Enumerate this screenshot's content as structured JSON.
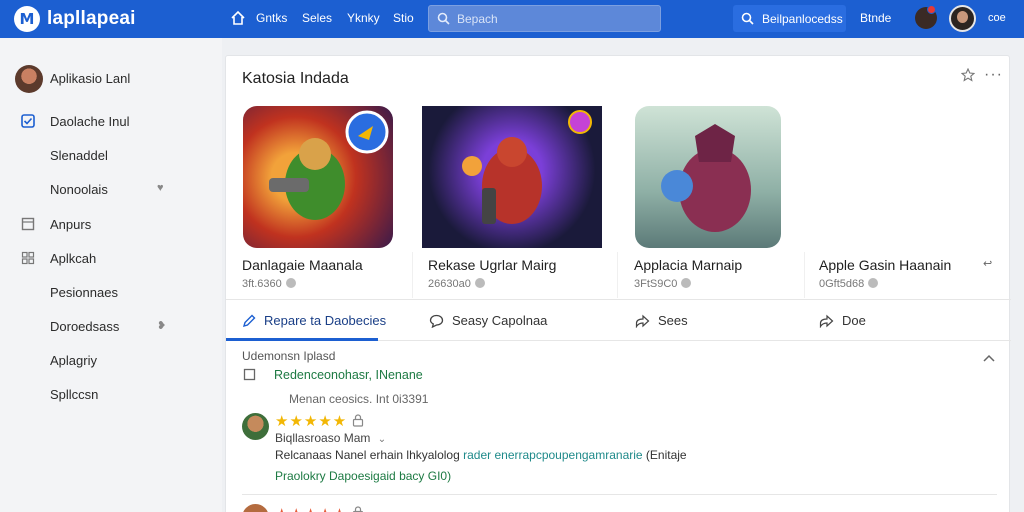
{
  "header": {
    "brand": "lapllapeai",
    "nav": [
      "Gntks",
      "Seles",
      "Yknky",
      "Stio"
    ],
    "search_placeholder": "Bepach",
    "search_button": "Beilpanlocedss",
    "right_link": "Btnde",
    "right_small": "coe"
  },
  "sidebar": {
    "profile_name": "Aplikasio Lanl",
    "items": [
      {
        "label": "Daolache Inul",
        "icon": "checkbox-icon",
        "chevron": ""
      },
      {
        "label": "Slenaddel",
        "icon": "",
        "chevron": ""
      },
      {
        "label": "Nonoolais",
        "icon": "",
        "chevron": "heart-icon"
      },
      {
        "label": "Anpurs",
        "icon": "box-icon",
        "chevron": ""
      },
      {
        "label": "Aplkcah",
        "icon": "grid-icon",
        "chevron": ""
      },
      {
        "label": "Pesionnaes",
        "icon": "",
        "chevron": ""
      },
      {
        "label": "Doroedsass",
        "icon": "",
        "chevron": "chevron-icon"
      },
      {
        "label": "Aplagriy",
        "icon": "",
        "chevron": ""
      },
      {
        "label": "Spllccsn",
        "icon": "",
        "chevron": ""
      }
    ]
  },
  "main": {
    "title": "Katosia Indada",
    "apps": [
      {
        "name": "Danlagaie Maanala",
        "meta": "3ft.6360"
      },
      {
        "name": "Rekase Ugrlar Mairg",
        "meta": "26630a0"
      },
      {
        "name": "Applacia Marnaip",
        "meta": "3FtS9C0"
      },
      {
        "name": "Apple Gasin Haanain",
        "meta": "0Gft5d68"
      }
    ],
    "tabs": [
      {
        "label": "Repare ta Daobecies",
        "icon": "pencil-icon"
      },
      {
        "label": "Seasy Capolnaa",
        "icon": "comment-icon"
      },
      {
        "label": "Sees",
        "icon": "share-icon"
      },
      {
        "label": "Doe",
        "icon": "share-icon"
      }
    ],
    "comments": {
      "heading": "Udemonsn Iplasd",
      "section_link": "Redenceonohasr, INenane",
      "section_sub": "Menan ceosics. Int 0i3391",
      "review": {
        "stars": "★★★★★",
        "user": "Biqllasroaso Mam",
        "text_before": "Relcanaas Nanel erhain lhkyalolog",
        "text_highlight": "rader enerrapcpoupengamranarie",
        "text_after": "(Enitaje",
        "link": "Praolokry Dapoesigaid bacy GI0)"
      },
      "review2_stars": "★★★★★"
    },
    "accent_colors": {
      "primary": "#1c5fd1",
      "link_green": "#1d7a43",
      "star": "#f2b705"
    }
  }
}
